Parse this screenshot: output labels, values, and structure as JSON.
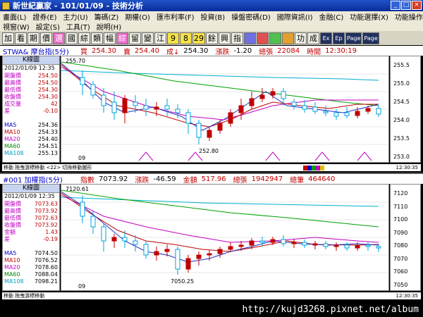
{
  "window": {
    "title": "新世紀贏家 - 101/01/09 - 技術分析"
  },
  "menu1": [
    "畫面(L)",
    "證券(E)",
    "主力(U)",
    "籌碼(Z)",
    "期權(O)",
    "匯市利率(F)",
    "投資(B)",
    "操盤密碼(D)",
    "國際資訊(I)",
    "金融(C)",
    "功能選擇(X)",
    "功能操作(F)"
  ],
  "menu2": [
    "視窗(W)",
    "設定(S)",
    "工具(T)",
    "說明(H)"
  ],
  "toolbar": [
    "加",
    "看",
    "期",
    "價",
    "選",
    "國",
    "綜",
    "類",
    "幅",
    "綜",
    "留",
    "變",
    "江",
    "9",
    "8",
    "29",
    "餘",
    "興",
    "指",
    "",
    "",
    "",
    "",
    "功",
    "成",
    "Ex",
    "Ep",
    "Page",
    "Page"
  ],
  "top": {
    "symbol": "STWA& 摩台指(5分)",
    "buy_label": "買",
    "buy": "254.30",
    "sell_label": "賣",
    "sell": "254.40",
    "deal_label": "成↓",
    "deal": "254.30",
    "chg_label": "漲跌",
    "chg": "-1.20",
    "vol_label": "總張",
    "vol": "22084",
    "time_label": "時間",
    "time": "12:30:19",
    "k_label": "K線圖",
    "date": "2012/01/09 12:35",
    "rows": [
      {
        "l": "開盤價",
        "r": "254.50"
      },
      {
        "l": "最高價",
        "r": "254.50"
      },
      {
        "l": "最低價",
        "r": "254.30"
      },
      {
        "l": "收盤價",
        "r": "254.30"
      },
      {
        "l": "成交量",
        "r": "42"
      },
      {
        "l": "差",
        "r": "-0.10"
      }
    ],
    "ma": [
      {
        "l": "MA5",
        "r": "254.36"
      },
      {
        "l": "MA10",
        "r": "254.33"
      },
      {
        "l": "MA20",
        "r": "254.40"
      },
      {
        "l": "MA60",
        "r": "254.51"
      },
      {
        "l": "MA108",
        "r": "255.13"
      }
    ],
    "axis_ticks": [
      "255.5",
      "255.0",
      "254.5",
      "254.0",
      "253.5",
      "253.0"
    ],
    "high_label": "255.70",
    "low_label": "252.80",
    "date_tick": "09",
    "footer_text": "移動 拖曳游標移動 <22> 切換移動圖形",
    "footer_time": "12:30:35"
  },
  "bottom": {
    "symbol": "#001 加權指(5分)",
    "idx_label": "指數",
    "idx": "7073.92",
    "chg_label": "漲跌",
    "chg": "-46.59",
    "amt_label": "金額",
    "amt": "517.96",
    "vol_label": "總張",
    "vol": "1942947",
    "cnt_label": "總筆",
    "cnt": "464640",
    "k_label": "K線圖",
    "date": "2012/01/09 12:35",
    "rows": [
      {
        "l": "開盤價",
        "r": "7073.63"
      },
      {
        "l": "最高價",
        "r": "7073.92"
      },
      {
        "l": "最低價",
        "r": "7072.63"
      },
      {
        "l": "收盤價",
        "r": "7073.92"
      },
      {
        "l": "金額",
        "r": "1.43"
      },
      {
        "l": "差",
        "r": "-0.19"
      }
    ],
    "ma": [
      {
        "l": "MA5",
        "r": "7074.50"
      },
      {
        "l": "MA10",
        "r": "7076.52"
      },
      {
        "l": "MA20",
        "r": "7078.60"
      },
      {
        "l": "MA60",
        "r": "7088.04"
      },
      {
        "l": "MA108",
        "r": "7098.21"
      }
    ],
    "axis_ticks": [
      "7120",
      "7110",
      "7100",
      "7090",
      "7080",
      "7070",
      "7060",
      "7050"
    ],
    "high_label": "7120.61",
    "low_label": "7050.25",
    "date_tick": "09",
    "footer_text": "移動 拖曳游標移動",
    "footer_time": "12:30:35"
  },
  "status": {
    "url": "http://kujd3268.pixnet.net/album"
  },
  "colors": {
    "up": "#c00000",
    "down": "#00a0e0",
    "ma5": "#2030c0",
    "ma10": "#c00000",
    "ma20": "#c000c0",
    "ma60": "#00a000",
    "ma108": "#00b0d0",
    "accent": "#c000c0"
  }
}
